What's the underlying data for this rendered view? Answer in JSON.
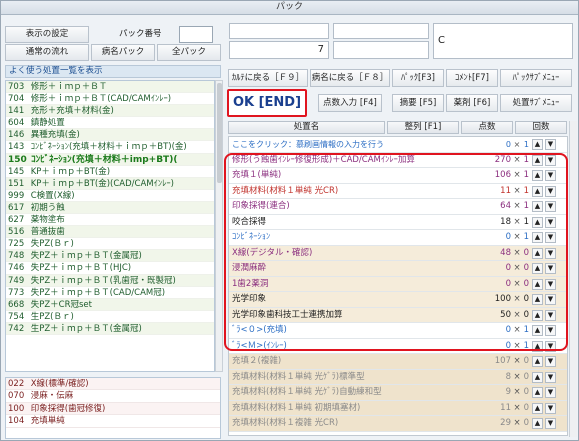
{
  "window": {
    "title": "パック"
  },
  "top_controls": {
    "display_settings": "表示の設定",
    "pack_number_label": "パック番号",
    "normal_flow": "通常の流れ",
    "disease_pack": "病名パック",
    "all_pack": "全パック"
  },
  "info_boxes": {
    "number": "7",
    "letter": "C"
  },
  "left_header": "よく使う処置一覧を表示",
  "left_list": [
    {
      "code": "703",
      "name": "修形＋ｉｍｐ＋ＢＴ"
    },
    {
      "code": "704",
      "name": "修形＋ｉｍｐ＋ＢＴ(CAD/CAMｲﾝﾚｰ)"
    },
    {
      "code": "141",
      "name": "充形＋充填＋材料(金)"
    },
    {
      "code": "604",
      "name": "鎮静処置"
    },
    {
      "code": "146",
      "name": "異種充填(金)"
    },
    {
      "code": "143",
      "name": "ｺﾝﾋﾞﾈｰｼｮﾝ(充填＋材料＋ｉｍｐ＋BT)(金)"
    },
    {
      "code": "150",
      "name": "ｺﾝﾋﾞﾈｰｼｮﾝ(充填＋材料＋imp+BT)(",
      "bold": true
    },
    {
      "code": "145",
      "name": "KP＋ｉｍｐ＋BT(金)"
    },
    {
      "code": "151",
      "name": "KP＋ｉｍｐ＋BT(金)(CAD/CAMｲﾝﾚｰ)"
    },
    {
      "code": "999",
      "name": "C検置(X線)"
    },
    {
      "code": "617",
      "name": "初期う蝕"
    },
    {
      "code": "627",
      "name": "薬物塗布"
    },
    {
      "code": "516",
      "name": "普通抜歯"
    },
    {
      "code": "725",
      "name": "失PZ(Ｂｒ)"
    },
    {
      "code": "748",
      "name": "失PZ＋ｉｍｐ＋ＢＴ(金属冠)"
    },
    {
      "code": "746",
      "name": "失PZ＋ｉｍｐ＋ＢＴ(HJC)"
    },
    {
      "code": "749",
      "name": "失PZ＋ｉｍｐ＋ＢＴ(乳歯冠・既製冠)"
    },
    {
      "code": "773",
      "name": "失PZ＋ｉｍｐ＋ＢＴ(CAD/CAM冠)"
    },
    {
      "code": "668",
      "name": "失PZ＋CR冠set"
    },
    {
      "code": "754",
      "name": "生PZ(Ｂｒ)"
    },
    {
      "code": "742",
      "name": "生PZ＋ｉｍｐ＋ＢＴ(金属冠)"
    }
  ],
  "left_list2": [
    {
      "code": "022",
      "name": "X線(標準/確認)"
    },
    {
      "code": "070",
      "name": "浸麻・伝麻"
    },
    {
      "code": "100",
      "name": "印象採得(歯冠修復)"
    },
    {
      "code": "104",
      "name": "充填単純"
    }
  ],
  "actions": {
    "row1": [
      "ｶﾙﾃに戻る［Ｆ９］",
      "病名に戻る［Ｆ８］",
      "ﾊﾟｯｸ[F3]",
      "ｺﾒﾝﾄ[F7]",
      "ﾊﾟｯｸｻﾌﾞﾒﾆｭｰ"
    ],
    "ok": "OK [END]",
    "row2": [
      "点数入力 [F4]",
      "摘要 [F5]",
      "薬剤 [F6]",
      "処置ｻﾌﾞﾒﾆｭｰ"
    ]
  },
  "table_header": {
    "name": "処置名",
    "sort": "整列 [F1]",
    "points": "点数",
    "count": "回数"
  },
  "table_rows": [
    {
      "name": "ここをクリック：慕刷画情報の入力を行う",
      "qty": "0",
      "cnt": "1",
      "style": "link"
    },
    {
      "name": "修形(う蝕歯ｲﾝﾚｰ修復形成)＋CAD/CAMｲﾝﾚｰ加算",
      "qty": "270",
      "cnt": "1",
      "style": "purple"
    },
    {
      "name": "充填１(単純)",
      "qty": "106",
      "cnt": "1",
      "style": "purple"
    },
    {
      "name": "充填材料(材料１単純 光CR)",
      "qty": "11",
      "cnt": "1",
      "style": "red"
    },
    {
      "name": "印象採得(連合)",
      "qty": "64",
      "cnt": "1",
      "style": "purple"
    },
    {
      "name": "咬合採得",
      "qty": "18",
      "cnt": "1",
      "style": "dark"
    },
    {
      "name": "ｺﾝﾋﾞﾈｰｼｮﾝ",
      "qty": "0",
      "cnt": "1",
      "style": "blue"
    },
    {
      "name": "X線(デジタル・確認)",
      "qty": "48",
      "cnt": "0",
      "style": "purple tan"
    },
    {
      "name": "浸潤麻酔",
      "qty": "0",
      "cnt": "0",
      "style": "purple tan"
    },
    {
      "name": "1歯2薬洞",
      "qty": "0",
      "cnt": "0",
      "style": "purple tan"
    },
    {
      "name": "光学印象",
      "qty": "100",
      "cnt": "0",
      "style": "dark tan"
    },
    {
      "name": "光学印象歯科技工士連携加算",
      "qty": "50",
      "cnt": "0",
      "style": "dark tan"
    },
    {
      "name": "ﾞﾗ<０>(充填)",
      "qty": "0",
      "cnt": "1",
      "style": "blue"
    },
    {
      "name": "ﾞﾗ<Ｍ>(ｲﾝﾚｰ)",
      "qty": "0",
      "cnt": "1",
      "style": "blue"
    },
    {
      "name": "充填２(複雑)",
      "qty": "107",
      "cnt": "0",
      "style": "muted tan2"
    },
    {
      "name": "充填材料(材料１単純 光ｹﾞﾗ)標準型",
      "qty": "8",
      "cnt": "0",
      "style": "muted tan2"
    },
    {
      "name": "充填材料(材料１単純 光ｹﾞﾗ)自動練和型",
      "qty": "9",
      "cnt": "0",
      "style": "muted tan2"
    },
    {
      "name": "充填材料(材料１単純 初期填塞材)",
      "qty": "11",
      "cnt": "0",
      "style": "muted tan2"
    },
    {
      "name": "充填材料(材料１複雑 光CR)",
      "qty": "29",
      "cnt": "0",
      "style": "muted tan2"
    }
  ]
}
